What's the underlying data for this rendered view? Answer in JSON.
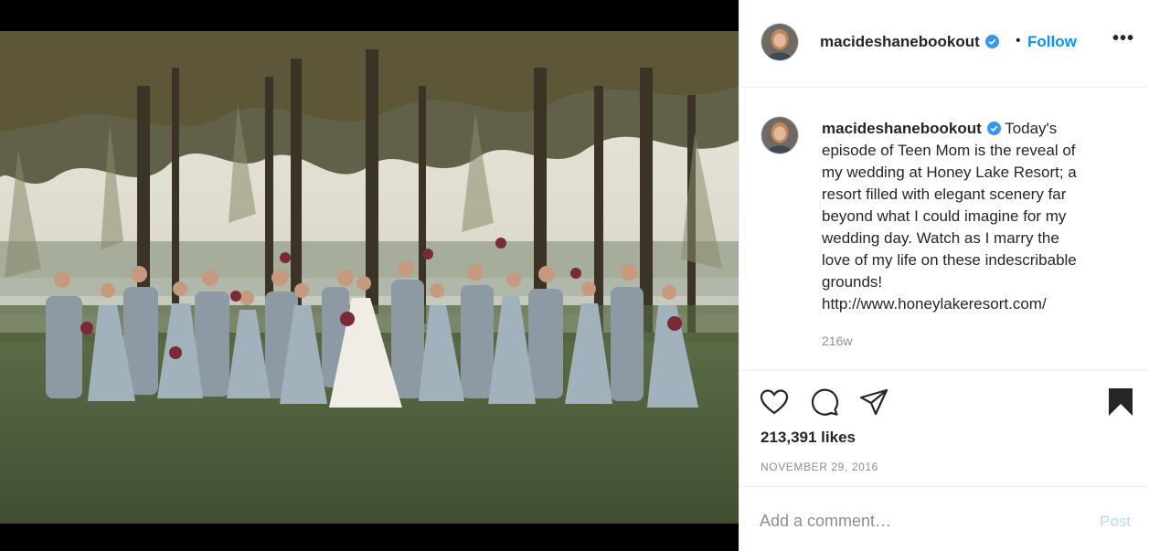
{
  "post": {
    "username": "macideshanebookout",
    "follow_label": "Follow",
    "separator": "•",
    "more_label": "•••",
    "caption_lines": [
      "Today's",
      "episode of Teen Mom is the reveal of",
      "my wedding at Honey Lake Resort; a",
      "resort filled with elegant scenery far",
      "beyond what I could imagine for my",
      "wedding day.  Watch as I marry the",
      "love of my life on these indescribable",
      "grounds!",
      "http://www.honeylakeresort.com/"
    ],
    "time_ago": "216w",
    "likes": "213,391 likes",
    "date": "NOVEMBER 29, 2016"
  },
  "comment_box": {
    "placeholder": "Add a comment…",
    "post_label": "Post"
  },
  "icons": {
    "verified": "verified-badge-icon",
    "like": "heart-icon",
    "comment": "comment-bubble-icon",
    "share": "paper-plane-icon",
    "save": "bookmark-icon",
    "more": "more-options-icon"
  },
  "colors": {
    "link_blue": "#0095f6",
    "post_disabled": "#b3dbff",
    "muted_text": "#8e8e8e",
    "border": "#efefef"
  }
}
